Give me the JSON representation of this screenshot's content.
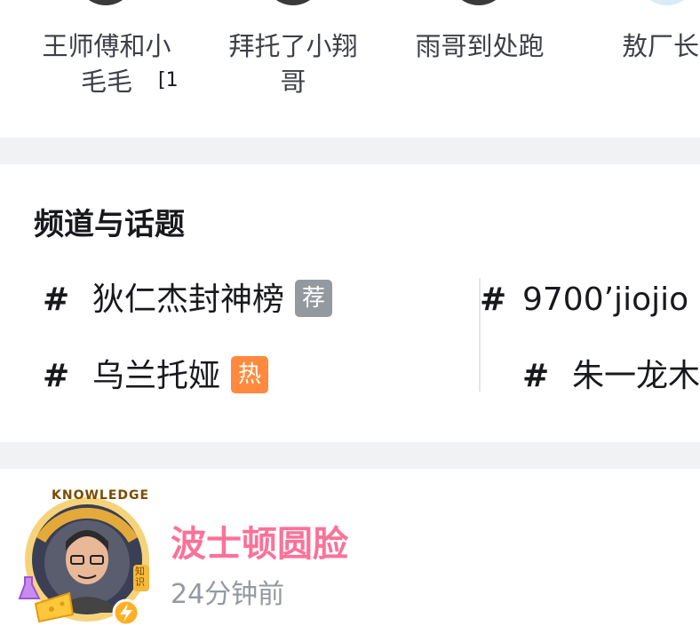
{
  "creators": [
    {
      "name": "王师傅和小毛毛",
      "badge": "[1"
    },
    {
      "name": "拜托了小翔哥"
    },
    {
      "name": "雨哥到处跑"
    },
    {
      "name": "敖厂长"
    }
  ],
  "channel": {
    "title": "频道与话题",
    "topics_left": [
      {
        "hash": "#",
        "name": "狄仁杰封神榜",
        "tag": "荐"
      },
      {
        "hash": "#",
        "name": "乌兰托娅",
        "tag": "热"
      }
    ],
    "topics_right": [
      {
        "hash": "#",
        "name": "9700’jiojio"
      },
      {
        "hash": "#",
        "name": "朱一龙木"
      }
    ]
  },
  "post": {
    "author": "波士顿圆脸",
    "time": "24分钟前",
    "avatar_frame_text": "KNOWLEDGE",
    "avatar_frame_badge": "知识"
  },
  "colors": {
    "accent_pink": "#fb7299",
    "tag_recommend": "#9499a0",
    "tag_hot": "#ff8a3d",
    "divider": "#f1f2f3"
  }
}
